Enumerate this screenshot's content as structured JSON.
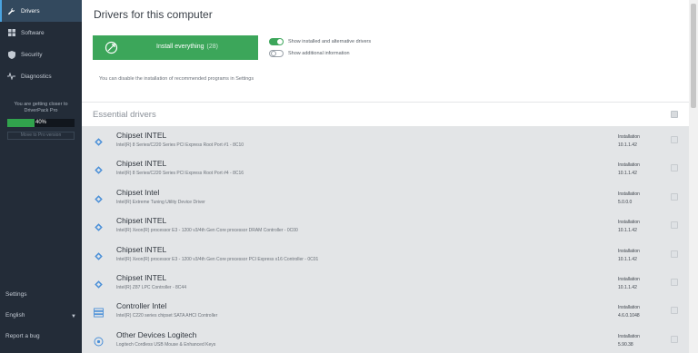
{
  "sidebar": {
    "nav": [
      {
        "label": "Drivers",
        "icon": "wrench-icon",
        "active": true
      },
      {
        "label": "Software",
        "icon": "grid-icon",
        "active": false
      },
      {
        "label": "Security",
        "icon": "shield-icon",
        "active": false
      },
      {
        "label": "Diagnostics",
        "icon": "pulse-icon",
        "active": false
      }
    ],
    "promo_line1": "You are getting closer to",
    "promo_line2": "DriverPack Pro",
    "progress_label": "40%",
    "progress_value": 0.4,
    "promo_button": "Move to Pro version",
    "settings_label": "Settings",
    "language_label": "English",
    "report_label": "Report a bug"
  },
  "main": {
    "title": "Drivers for this computer",
    "install_button": {
      "label": "Install everything",
      "count": "(28)"
    },
    "toggle_alternative": "Show installed and alternative drivers",
    "toggle_additional": "Show additional information",
    "hint": "You can disable the installation of recommended programs in Settings",
    "section_title": "Essential drivers",
    "drivers": [
      {
        "name": "Chipset INTEL",
        "desc": "Intel(R) 8 Series/C220 Series PCI Express Root Port #1 - 8C10",
        "inst": "Installation",
        "version": "10.1.1.42",
        "icon": "chipset-icon"
      },
      {
        "name": "Chipset INTEL",
        "desc": "Intel(R) 8 Series/C220 Series PCI Express Root Port #4 - 8C16",
        "inst": "Installation",
        "version": "10.1.1.42",
        "icon": "chipset-icon"
      },
      {
        "name": "Chipset Intel",
        "desc": "Intel(R) Extreme Tuning Utility Device Driver",
        "inst": "Installation",
        "version": "5.0.0.0",
        "icon": "chipset-icon"
      },
      {
        "name": "Chipset INTEL",
        "desc": "Intel(R) Xeon(R) processor E3 - 1200 v3/4th Gen Core processor DRAM Controller - 0C00",
        "inst": "Installation",
        "version": "10.1.1.42",
        "icon": "chipset-icon"
      },
      {
        "name": "Chipset INTEL",
        "desc": "Intel(R) Xeon(R) processor E3 - 1200 v3/4th Gen Core processor PCI Express x16 Controller - 0C01",
        "inst": "Installation",
        "version": "10.1.1.42",
        "icon": "chipset-icon"
      },
      {
        "name": "Chipset INTEL",
        "desc": "Intel(R) Z87 LPC Controller - 8C44",
        "inst": "Installation",
        "version": "10.1.1.42",
        "icon": "chipset-icon"
      },
      {
        "name": "Controller Intel",
        "desc": "Intel(R) C220 series chipset SATA AHCI Controller",
        "inst": "Installation",
        "version": "4.6.0.1048",
        "icon": "controller-icon"
      },
      {
        "name": "Other Devices Logitech",
        "desc": "Logitech Cordless USB Mouse & Enhanced Keys",
        "inst": "Installation",
        "version": "5.90.38",
        "icon": "device-icon"
      }
    ]
  },
  "colors": {
    "sidebar_bg": "#232c38",
    "accent_green": "#3ca65a",
    "accent_blue": "#4a8fd8",
    "list_bg": "#e3e5e7"
  }
}
